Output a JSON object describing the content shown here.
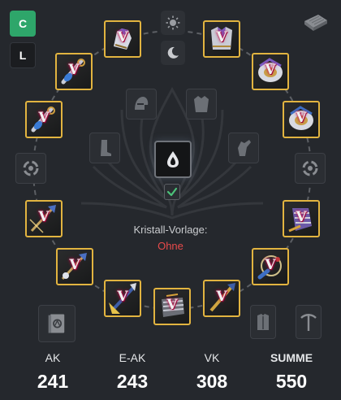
{
  "modes": {
    "c_label": "C",
    "l_label": "L"
  },
  "slots": {
    "v_marker": "V",
    "top_left": {
      "item": "gloves"
    },
    "upper_left": {
      "item": "bracelet"
    },
    "mid_left": {
      "item": "bracelet"
    },
    "left_lower": {
      "item": "glaive"
    },
    "lower_left": {
      "item": "glaive"
    },
    "bottom_left": {
      "item": "glaive"
    },
    "bottom_center": {
      "item": "gauntlet"
    },
    "bottom_right": {
      "item": "glaive"
    },
    "top_right": {
      "item": "chest-armor"
    },
    "upper_right": {
      "item": "shield"
    },
    "mid_right": {
      "item": "shield"
    },
    "right_lower": {
      "item": "gauntlet"
    },
    "lower_right": {
      "item": "belt"
    }
  },
  "icons": {
    "tray": "tray-icon",
    "sun": "sun-icon",
    "moon": "moon-icon",
    "helmet": "helmet-icon",
    "chest": "chest-armor-icon",
    "boots": "boots-icon",
    "gloves": "gloves-icon",
    "center": "crystal-icon",
    "check": "check-icon",
    "left_round": "circle-arrows-icon",
    "right_round": "circle-arrows-icon",
    "book": "tome-icon",
    "torso": "torso-icon",
    "pickaxe": "pickaxe-icon"
  },
  "crystal": {
    "label": "Kristall-Vorlage:",
    "value": "Ohne"
  },
  "stats": {
    "ak": {
      "label": "AK",
      "value": "241"
    },
    "eak": {
      "label": "E-AK",
      "value": "243"
    },
    "vk": {
      "label": "VK",
      "value": "308"
    },
    "total": {
      "label": "SUMME",
      "value": "550"
    }
  },
  "colors": {
    "background": "#25282d",
    "slot_border": "#e2b440",
    "mode_active": "#2ea66a",
    "warning_text": "#e84a4a"
  }
}
